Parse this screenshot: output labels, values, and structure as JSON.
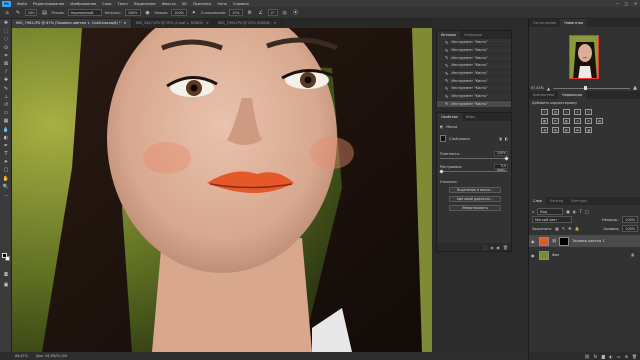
{
  "app": {
    "logo": "Ps",
    "menu": [
      "Файл",
      "Редактирование",
      "Изображение",
      "Слои",
      "Текст",
      "Выделение",
      "Фильтр",
      "3D",
      "Просмотр",
      "Окно",
      "Справка"
    ],
    "window_controls": [
      "—",
      "□",
      "✕"
    ]
  },
  "options": {
    "brush_size": "200",
    "mode_label": "Режим:",
    "mode_value": "Нормальный",
    "opacity_label": "Непрозр.:",
    "opacity_value": "100%",
    "flow_label": "Нажим:",
    "flow_value": "100%",
    "smoothing_label": "Сглаживание:",
    "smoothing_value": "10%",
    "angle_value": "0°"
  },
  "tabs": [
    {
      "label": "IMG_7962.JPG @ 67% (Заливка цветом 1, Слой-маска/8) *",
      "active": true
    },
    {
      "label": "IMG_3627.JPG @ 25% (Слой 1, RGB/8)",
      "active": false
    },
    {
      "label": "IMG_7993.JPG @ 25% (RGB/8)",
      "active": false
    }
  ],
  "status": {
    "zoom": "66,67%",
    "doc": "Док: 34,3M/51,5M"
  },
  "history": {
    "tabs": [
      "История",
      "Операции"
    ],
    "items": [
      "Инструмент \"Кисть\"",
      "Инструмент \"Кисть\"",
      "Инструмент \"Кисть\"",
      "Инструмент \"Кисть\"",
      "Инструмент \"Кисть\"",
      "Инструмент \"Кисть\"",
      "Инструмент \"Кисть\"",
      "Инструмент \"Кисть\"",
      "Инструмент \"Кисть\""
    ]
  },
  "properties": {
    "tabs": [
      "Свойства",
      "Инфо"
    ],
    "section": "Маски",
    "mask_label": "Слой-маска",
    "density_label": "Плотность:",
    "density_value": "100%",
    "feather_label": "Растушевка:",
    "feather_value": "0,0 пикс.",
    "refine_label": "Уточнить:",
    "btn_select_mask": "Выделение и маска...",
    "btn_color_range": "Цветовой диапазон...",
    "btn_invert": "Инвертировать"
  },
  "dock": {
    "top_tabs": [
      "Гистограмма",
      "Навигатор"
    ],
    "nav_zoom": "67,43%",
    "adjust_tabs": [
      "Библиотеки",
      "Коррекция"
    ],
    "adjust_title": "Добавить корректировку",
    "layers_tabs": [
      "Слои",
      "Каналы",
      "Контуры"
    ],
    "kind_label": "Вид",
    "blend_mode": "Мягкий свет",
    "opacity_label": "Непрозр.:",
    "opacity_value": "100%",
    "lock_label": "Закрепить:",
    "fill_label": "Заливка:",
    "fill_value": "100%",
    "layers": [
      {
        "name": "Заливка цветом 1",
        "selected": true
      },
      {
        "name": "Фон",
        "selected": false
      }
    ]
  },
  "colors": {
    "accent": "#31a8ff",
    "fill_layer_color": "#e4582a",
    "selection": "#4b4b4b"
  }
}
